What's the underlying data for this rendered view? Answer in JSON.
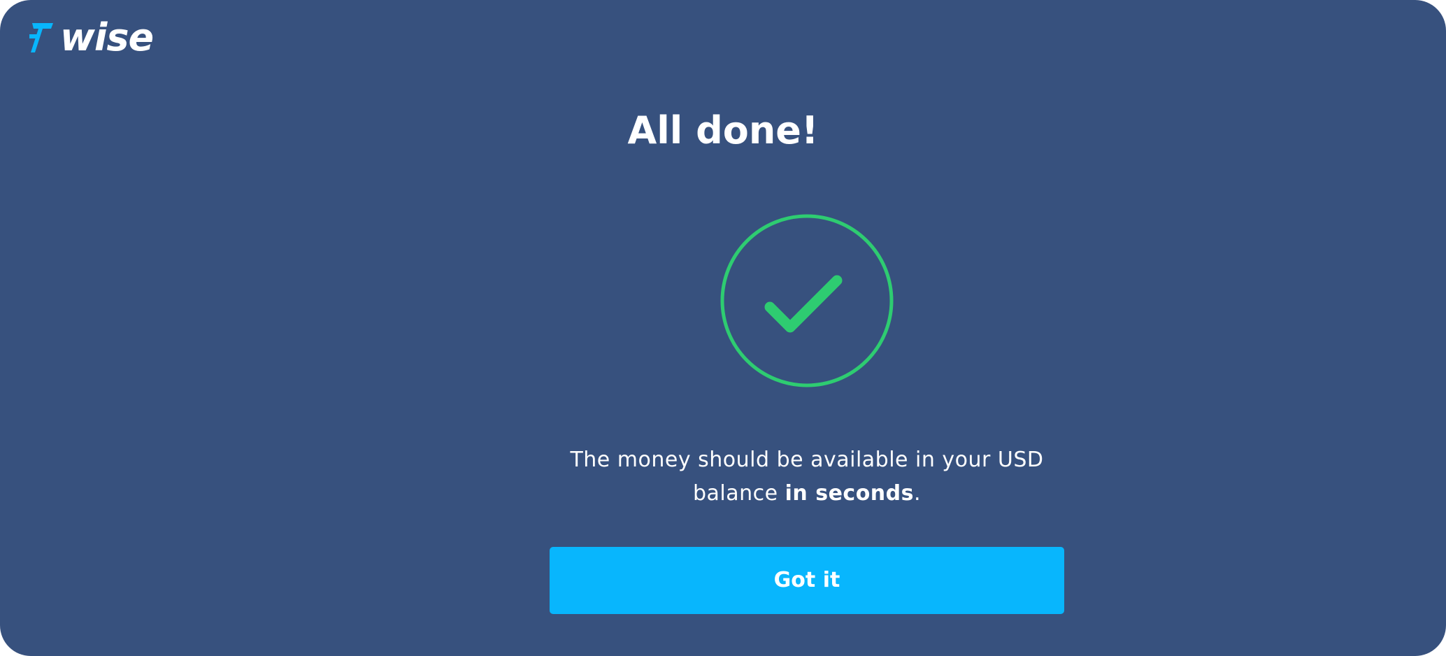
{
  "brand": {
    "name": "wise",
    "logo_icon": "wise-flag-icon",
    "mark_color": "#08b6fd"
  },
  "dialog": {
    "title": "All done!",
    "status_icon": "checkmark-circle-icon",
    "status_color": "#2ecc71",
    "message_prefix": "The money should be available in your USD balance",
    "message_emphasis": "in seconds",
    "message_suffix": "."
  },
  "actions": {
    "primary_label": "Got it"
  },
  "colors": {
    "background": "#37517e",
    "button": "#08b6fd",
    "text": "#ffffff"
  }
}
